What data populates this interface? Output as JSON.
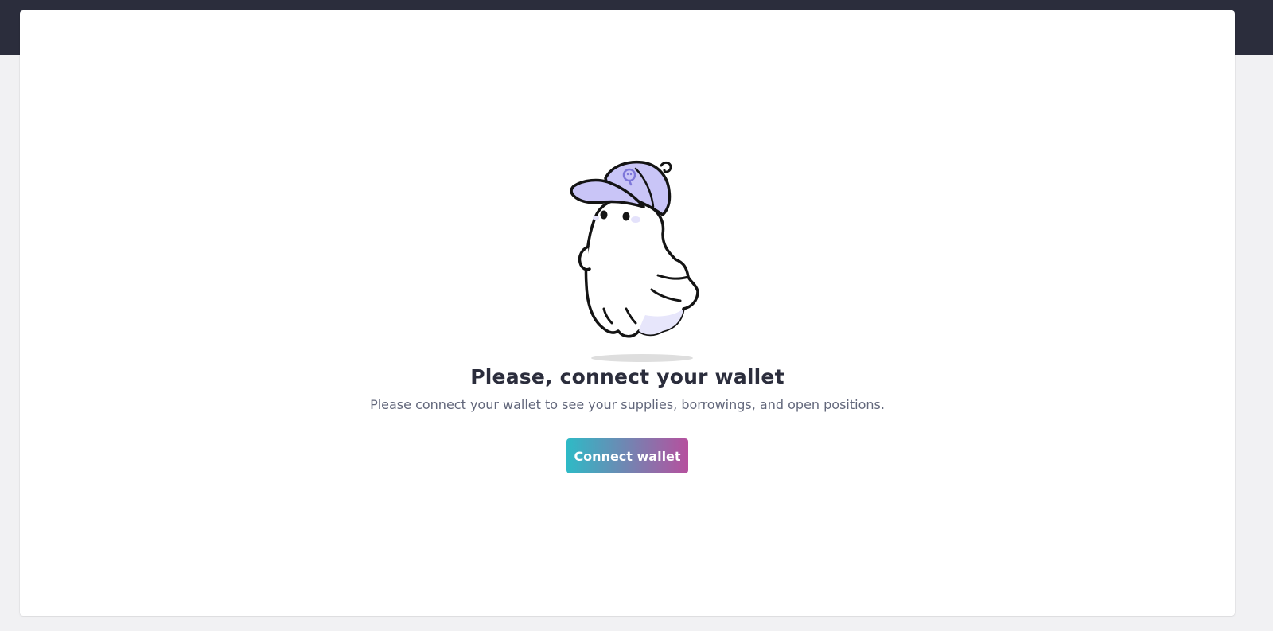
{
  "empty_state": {
    "illustration": "ghost-with-cap-illustration",
    "title": "Please, connect your wallet",
    "description": "Please connect your wallet to see your supplies, borrowings, and open positions.",
    "connect_button_label": "Connect wallet"
  },
  "colors": {
    "header_background": "#2b2d3c",
    "page_background": "#f1f1f3",
    "card_background": "#ffffff",
    "title_text": "#2b2d3c",
    "description_text": "#62677b",
    "button_gradient_start": "#2ebac6",
    "button_gradient_end": "#b6509e",
    "cap_color": "#c9c5f7"
  }
}
